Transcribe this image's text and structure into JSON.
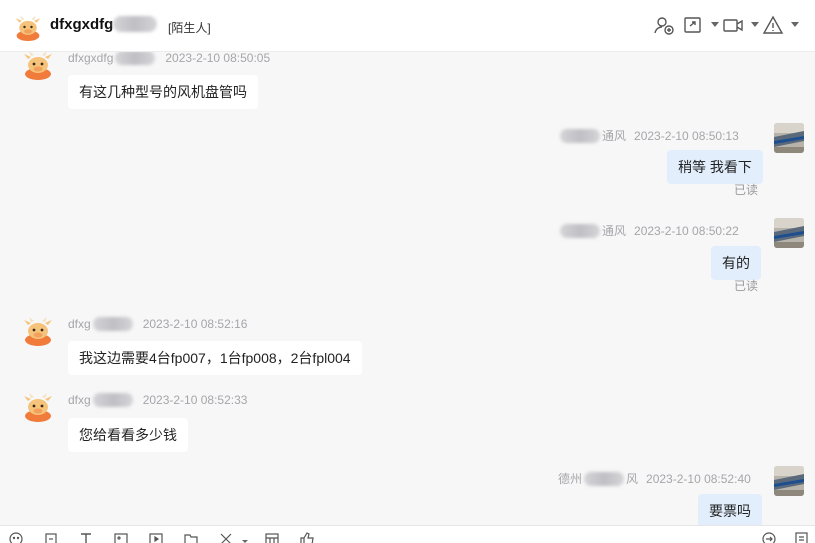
{
  "header": {
    "contact_name": "dfxgxdfg",
    "tag": "[陌生人]",
    "icons": [
      "add-contact-icon",
      "share-icon",
      "video-call-icon",
      "report-icon",
      "more-icon"
    ]
  },
  "messages": [
    {
      "side": "left",
      "sender": "dfxgxdfg",
      "time": "2023-2-10 08:50:05",
      "text": "有这几种型号的风机盘管吗"
    },
    {
      "side": "right",
      "sender": "通风",
      "time": "2023-2-10 08:50:13",
      "text": "稍等 我看下",
      "status": "已读"
    },
    {
      "side": "right",
      "sender": "通风",
      "time": "2023-2-10 08:50:22",
      "text": "有的",
      "status": "已读"
    },
    {
      "side": "left",
      "sender": "dfxg",
      "time": "2023-2-10 08:52:16",
      "text": "我这边需要4台fp007，1台fp008，2台fpl004"
    },
    {
      "side": "left",
      "sender": "dfxg",
      "time": "2023-2-10 08:52:33",
      "text": "您给看看多少钱"
    },
    {
      "side": "right",
      "sender_prefix": "德州",
      "sender": "风",
      "time": "2023-2-10 08:52:40",
      "text": "要票吗"
    }
  ],
  "toolbar": {
    "icons": [
      "emoji-icon",
      "screenshot-icon",
      "font-icon",
      "image-icon",
      "video-icon",
      "folder-icon",
      "scissors-icon",
      "calendar-icon",
      "thumbs-up-icon",
      "send-arrow-icon",
      "history-icon"
    ]
  },
  "colors": {
    "bubble_self": "#e3eefc",
    "bubble_other": "#ffffff",
    "background": "#f7f7f8"
  }
}
